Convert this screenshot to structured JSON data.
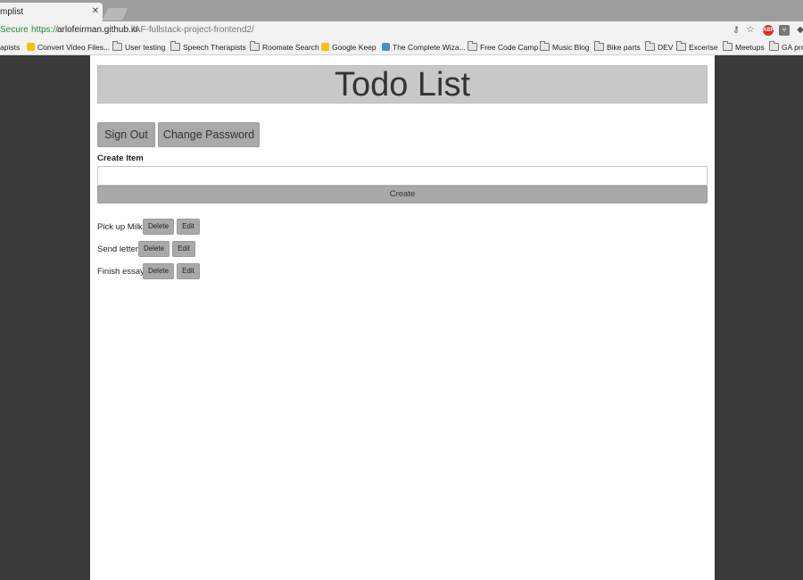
{
  "browser": {
    "tab_title": "mplist",
    "secure_label": "Secure",
    "url_scheme": "https://",
    "url_host": "arlofeirman.github.io",
    "url_path": "/AF-fullstack-project-frontend2/",
    "bookmarks": [
      "apists",
      "Convert Video Files...",
      "User testing",
      "Speech Therapists",
      "Roomate Search",
      "Google Keep",
      "The Complete Wiza...",
      "Free Code Camp",
      "Music Blog",
      "Bike parts",
      "DEV",
      "Excerise",
      "Meetups",
      "GA pro"
    ]
  },
  "app": {
    "title": "Todo List",
    "sign_out_label": "Sign Out",
    "change_password_label": "Change Password",
    "create_label": "Create Item",
    "create_input_value": "",
    "create_button_label": "Create",
    "todos": [
      {
        "text": "Pick up Milk",
        "delete_label": "Delete",
        "edit_label": "Edit"
      },
      {
        "text": "Send letter",
        "delete_label": "Delete",
        "edit_label": "Edit"
      },
      {
        "text": "Finish essay",
        "delete_label": "Delete",
        "edit_label": "Edit"
      }
    ]
  },
  "colors": {
    "page_background": "#3a3a3a",
    "button_gray": "#a9a9a9",
    "header_gray": "#c8c8c8",
    "secure_green": "#1e8e3e"
  }
}
